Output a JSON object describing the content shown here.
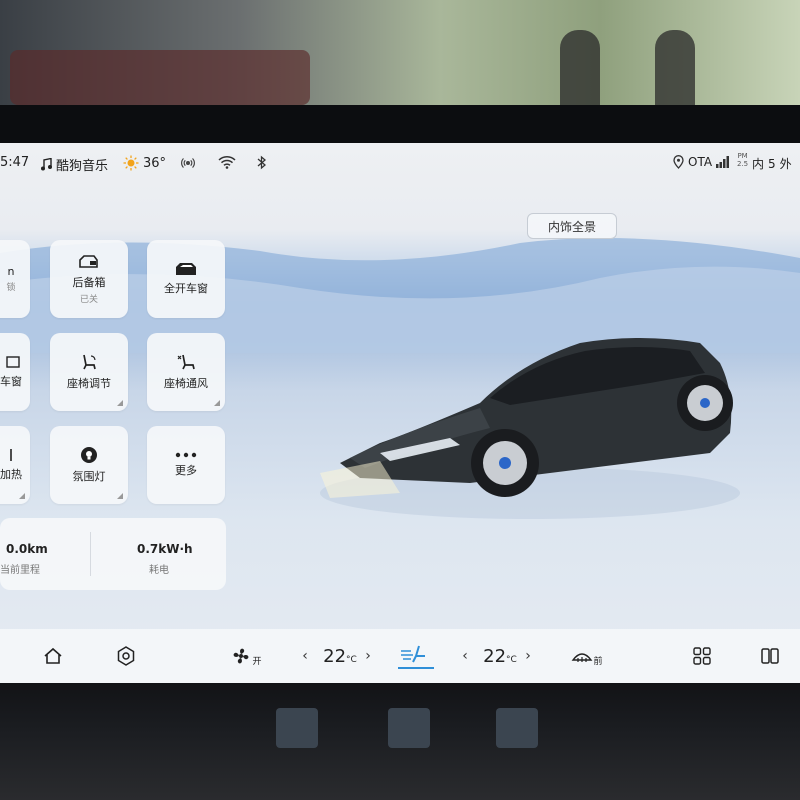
{
  "status": {
    "time": "5:47",
    "music_app": "酷狗音乐",
    "temperature": "36°",
    "ota": "OTA",
    "pm_label": "PM",
    "pm_value": "2.5",
    "inside_label": "内",
    "inside_value": "5",
    "outside_label": "外"
  },
  "view_button": "内饰全景",
  "tiles": {
    "partial_top": "n",
    "partial_top_sub": "锁",
    "trunk_label": "后备箱",
    "trunk_sub": "已关",
    "sunroof_label": "全开车窗",
    "partial_window": "车窗",
    "seat_adjust": "座椅调节",
    "seat_vent": "座椅通风",
    "partial_heat": "加热",
    "ambient_light": "氛围灯",
    "more": "更多"
  },
  "stats": {
    "distance_value": "0.0km",
    "distance_label": "当前里程",
    "energy_value": "0.7kW·h",
    "energy_label": "耗电"
  },
  "dock": {
    "fan_label": "开",
    "left_temp": "22",
    "right_temp": "22",
    "temp_unit": "°C",
    "defrost_label": "前",
    "arrow_left": "‹",
    "arrow_right": "›"
  },
  "colors": {
    "accent": "#2f8fd8",
    "car_body": "#2d3236"
  },
  "icons": [
    "music-note-icon",
    "sun-icon",
    "radar-icon",
    "wifi-icon",
    "bluetooth-icon",
    "location-icon",
    "signal-icon",
    "trunk-icon",
    "sunroof-icon",
    "window-icon",
    "seat-adjust-icon",
    "seat-vent-icon",
    "heat-icon",
    "ambient-light-icon",
    "more-dots-icon",
    "home-icon",
    "hexagon-settings-icon",
    "fan-icon",
    "airflow-icon",
    "defrost-icon",
    "grid-apps-icon",
    "split-screen-icon"
  ]
}
